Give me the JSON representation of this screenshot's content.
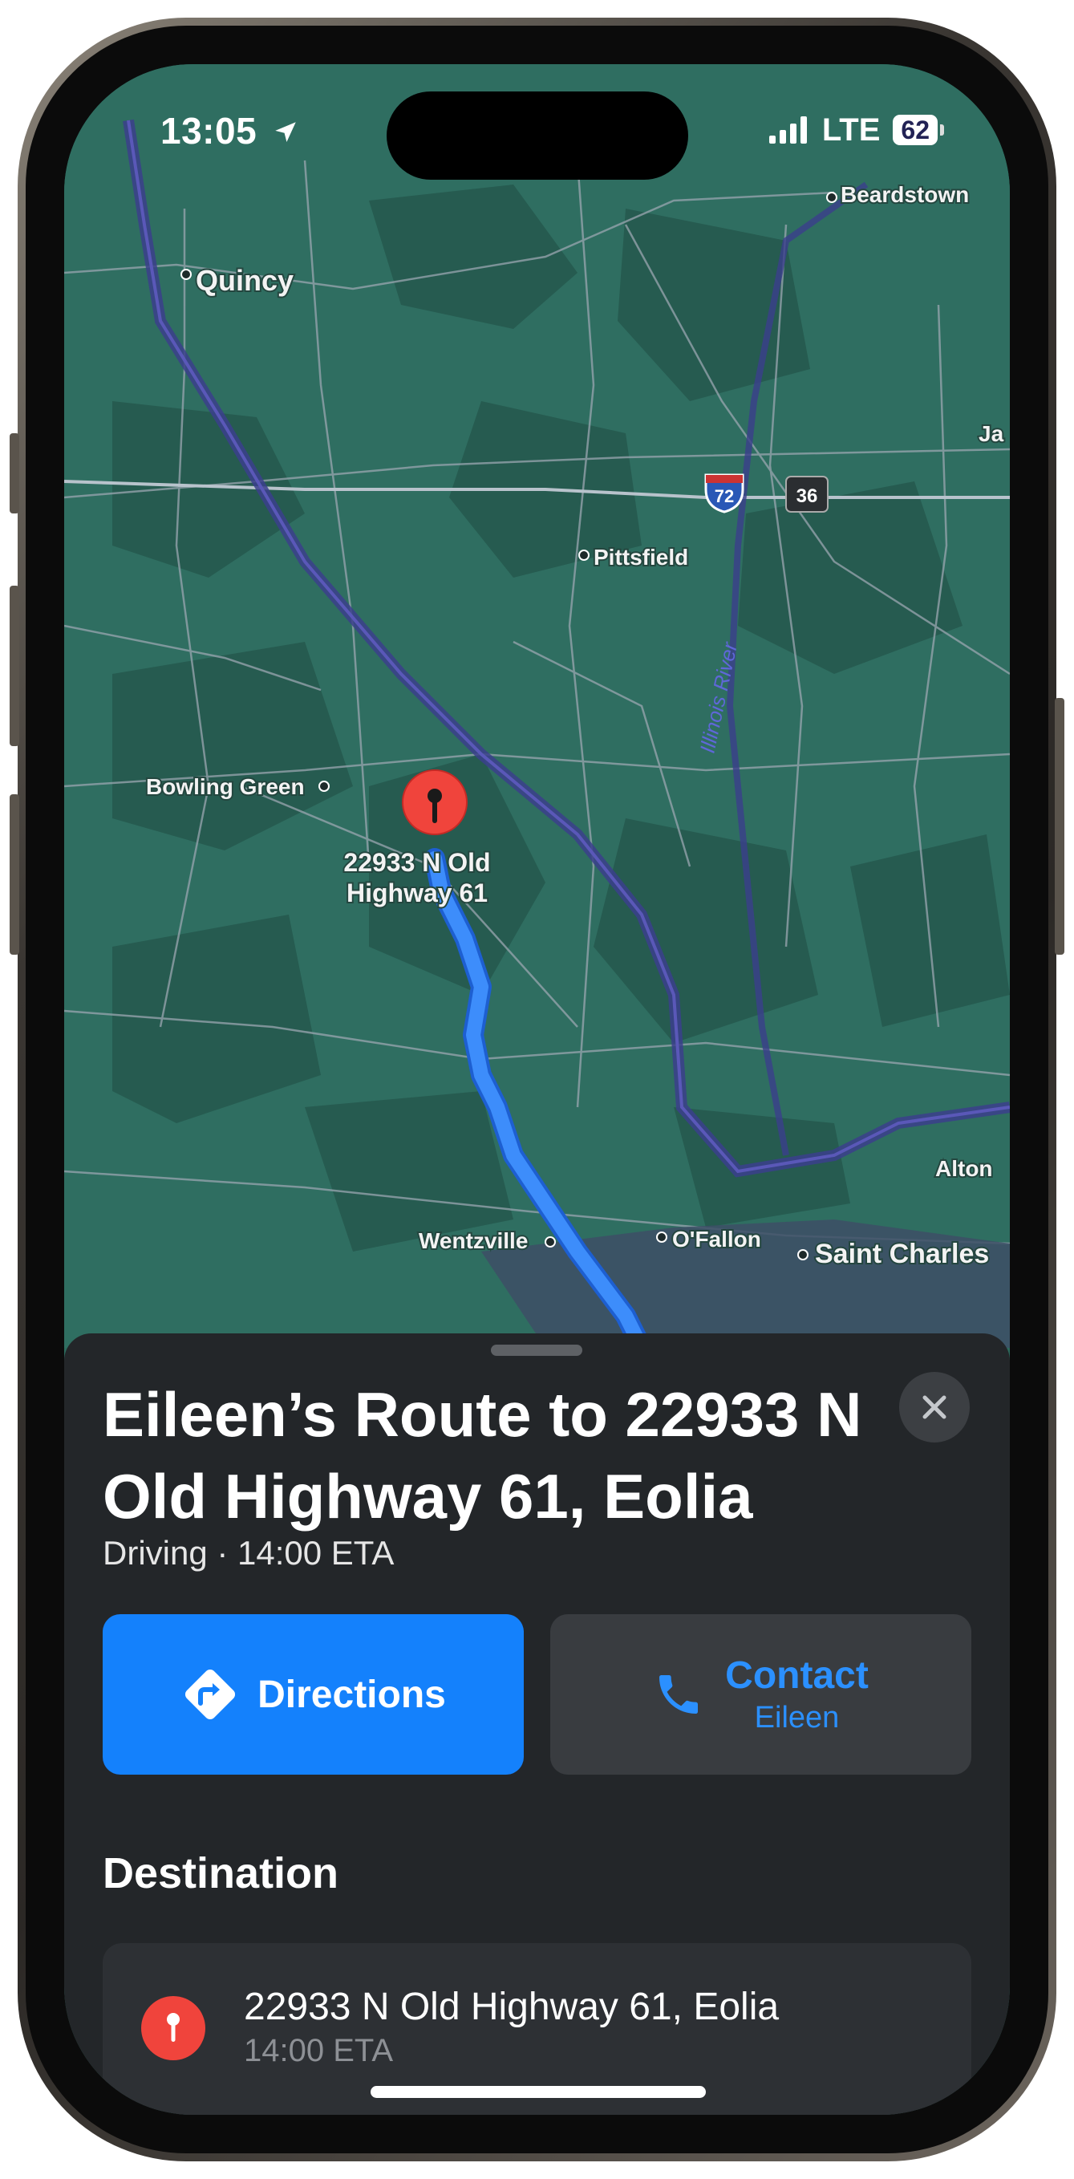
{
  "status_bar": {
    "time": "13:05",
    "network": "LTE",
    "battery": "62"
  },
  "map": {
    "labels": {
      "quincy": "Quincy",
      "beardstown": "Beardstown",
      "ja": "Ja",
      "pittsfield": "Pittsfield",
      "illinois_river": "Illinois River",
      "bowling_green": "Bowling Green",
      "pin_line1": "22933 N Old",
      "pin_line2": "Highway 61",
      "wentzville": "Wentzville",
      "ofallon": "O'Fallon",
      "saint_charles": "Saint Charles",
      "alton": "Alton",
      "shield_72": "72",
      "shield_36": "36"
    }
  },
  "sheet": {
    "title": "Eileen’s Route to 22933 N Old Highway 61, Eolia",
    "subtitle": "Driving · 14:00 ETA",
    "directions_label": "Directions",
    "contact_label": "Contact",
    "contact_name": "Eileen",
    "section_title": "Destination",
    "destination": {
      "name": "22933 N Old Highway 61, Eolia",
      "eta": "14:00 ETA"
    }
  },
  "colors": {
    "accent": "#1481fc",
    "route": "#3d8dfb",
    "pin": "#f0443c",
    "sheet": "#232629"
  }
}
